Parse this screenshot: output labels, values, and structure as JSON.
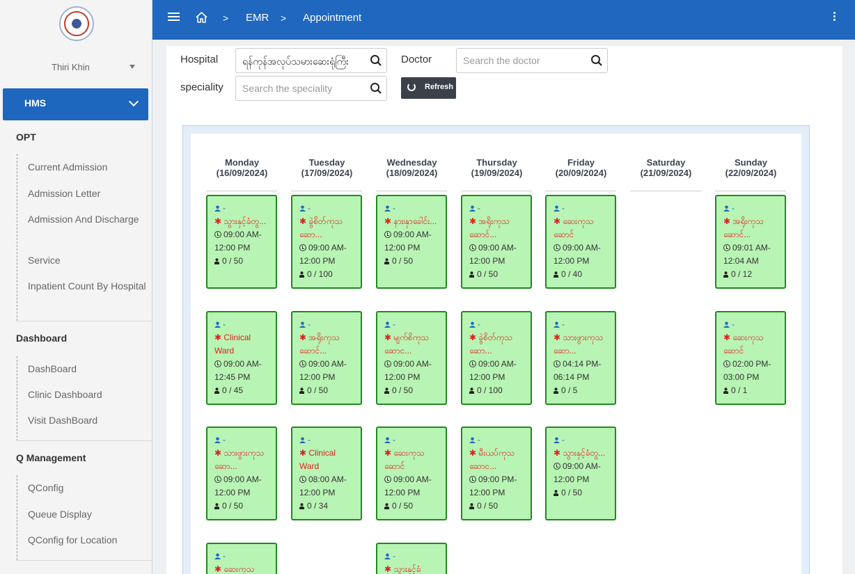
{
  "user": {
    "name": "Thiri Khin"
  },
  "sidebar": {
    "module": "HMS",
    "sections": [
      {
        "title": "OPT",
        "items": [
          "Current Admission",
          "Admission Letter",
          "Admission And Discharge",
          "Service",
          "Inpatient Count By Hospital"
        ]
      },
      {
        "title": "Dashboard",
        "items": [
          "DashBoard",
          "Clinic Dashboard",
          "Visit DashBoard"
        ]
      },
      {
        "title": "Q Management",
        "items": [
          "QConfig",
          "Queue Display",
          "QConfig for Location"
        ]
      }
    ]
  },
  "breadcrumb": {
    "sep": ">",
    "emr": "EMR",
    "current": "Appointment"
  },
  "filters": {
    "hospital_label": "Hospital",
    "hospital_value": "ရန်ကုန်အလုပ်သမားဆေးရုံကြီး",
    "doctor_label": "Doctor",
    "doctor_placeholder": "Search the doctor",
    "speciality_label": "speciality",
    "speciality_placeholder": "Search the speciality",
    "refresh_label": "Refresh"
  },
  "days": [
    {
      "name": "Monday",
      "date": "(16/09/2024)"
    },
    {
      "name": "Tuesday",
      "date": "(17/09/2024)"
    },
    {
      "name": "Wednesday",
      "date": "(18/09/2024)"
    },
    {
      "name": "Thursday",
      "date": "(19/09/2024)"
    },
    {
      "name": "Friday",
      "date": "(20/09/2024)"
    },
    {
      "name": "Saturday",
      "date": "(21/09/2024)"
    },
    {
      "name": "Sunday",
      "date": "(22/09/2024)"
    }
  ],
  "appointments": [
    {
      "day": 0,
      "row": 0,
      "doctor": "-",
      "location": "သွားနှင့်ခံတွ...",
      "time": "09:00 AM-12:00 PM",
      "count": "0 / 50"
    },
    {
      "day": 1,
      "row": 0,
      "doctor": "-",
      "location": "ခွဲစိတ်ကုသဆော...",
      "time": "09:00 AM-12:00 PM",
      "count": "0 / 100"
    },
    {
      "day": 2,
      "row": 0,
      "doctor": "-",
      "location": "နား၊နှာခေါင်း...",
      "time": "09:00 AM-12:00 PM",
      "count": "0 / 50"
    },
    {
      "day": 3,
      "row": 0,
      "doctor": "-",
      "location": "အရိုးကုသဆောင်...",
      "time": "09:00 AM-12:00 PM",
      "count": "0 / 50"
    },
    {
      "day": 4,
      "row": 0,
      "doctor": "-",
      "location": "ဆေးကုသဆောင်",
      "time": "09:00 AM-12:00 PM",
      "count": "0 / 40"
    },
    {
      "day": 6,
      "row": 0,
      "doctor": "-",
      "location": "အရိုးကုသဆောင်...",
      "time": "09:01 AM-12:04 AM",
      "count": "0 / 12"
    },
    {
      "day": 0,
      "row": 1,
      "doctor": "-",
      "location": "Clinical Ward",
      "time": "09:00 AM-12:45 PM",
      "count": "0 / 45"
    },
    {
      "day": 1,
      "row": 1,
      "doctor": "-",
      "location": "အရိုးကုသဆောင်...",
      "time": "09:00 AM-12:00 PM",
      "count": "0 / 50"
    },
    {
      "day": 2,
      "row": 1,
      "doctor": "-",
      "location": "မျက်စိကုသဆောင...",
      "time": "09:00 AM-12:00 PM",
      "count": "0 / 50"
    },
    {
      "day": 3,
      "row": 1,
      "doctor": "-",
      "location": "ခွဲစိတ်ကုသဆော...",
      "time": "09:00 AM-12:00 PM",
      "count": "0 / 100"
    },
    {
      "day": 4,
      "row": 1,
      "doctor": "-",
      "location": "သားဖွားကုသဆော...",
      "time": "04:14 PM-06:14 PM",
      "count": "0 / 5"
    },
    {
      "day": 6,
      "row": 1,
      "doctor": "-",
      "location": "ဆေးကုသဆောင်",
      "time": "02:00 PM-03:00 PM",
      "count": "0 / 1"
    },
    {
      "day": 0,
      "row": 2,
      "doctor": "-",
      "location": "သားဖွားကုသဆော...",
      "time": "09:00 AM-12:00 PM",
      "count": "0 / 50"
    },
    {
      "day": 1,
      "row": 2,
      "doctor": "-",
      "location": "Clinical Ward",
      "time": "08:00 AM-12:00 PM",
      "count": "0 / 34"
    },
    {
      "day": 2,
      "row": 2,
      "doctor": "-",
      "location": "ဆေးကုသဆောင်",
      "time": "09:00 AM-12:00 PM",
      "count": "0 / 50"
    },
    {
      "day": 3,
      "row": 2,
      "doctor": "-",
      "location": "မီးယပ်ကုသဆောင...",
      "time": "09:00 PM-12:00 PM",
      "count": "0 / 50"
    },
    {
      "day": 4,
      "row": 2,
      "doctor": "-",
      "location": "သွားနှင့်ခံတွ...",
      "time": "09:00 AM-12:00 PM",
      "count": "0 / 50"
    },
    {
      "day": 0,
      "row": 3,
      "doctor": "-",
      "location": "ဆေးကုသ",
      "time": "",
      "count": ""
    },
    {
      "day": 2,
      "row": 3,
      "doctor": "-",
      "location": "သွားနှင့်ခံ",
      "time": "",
      "count": ""
    }
  ]
}
